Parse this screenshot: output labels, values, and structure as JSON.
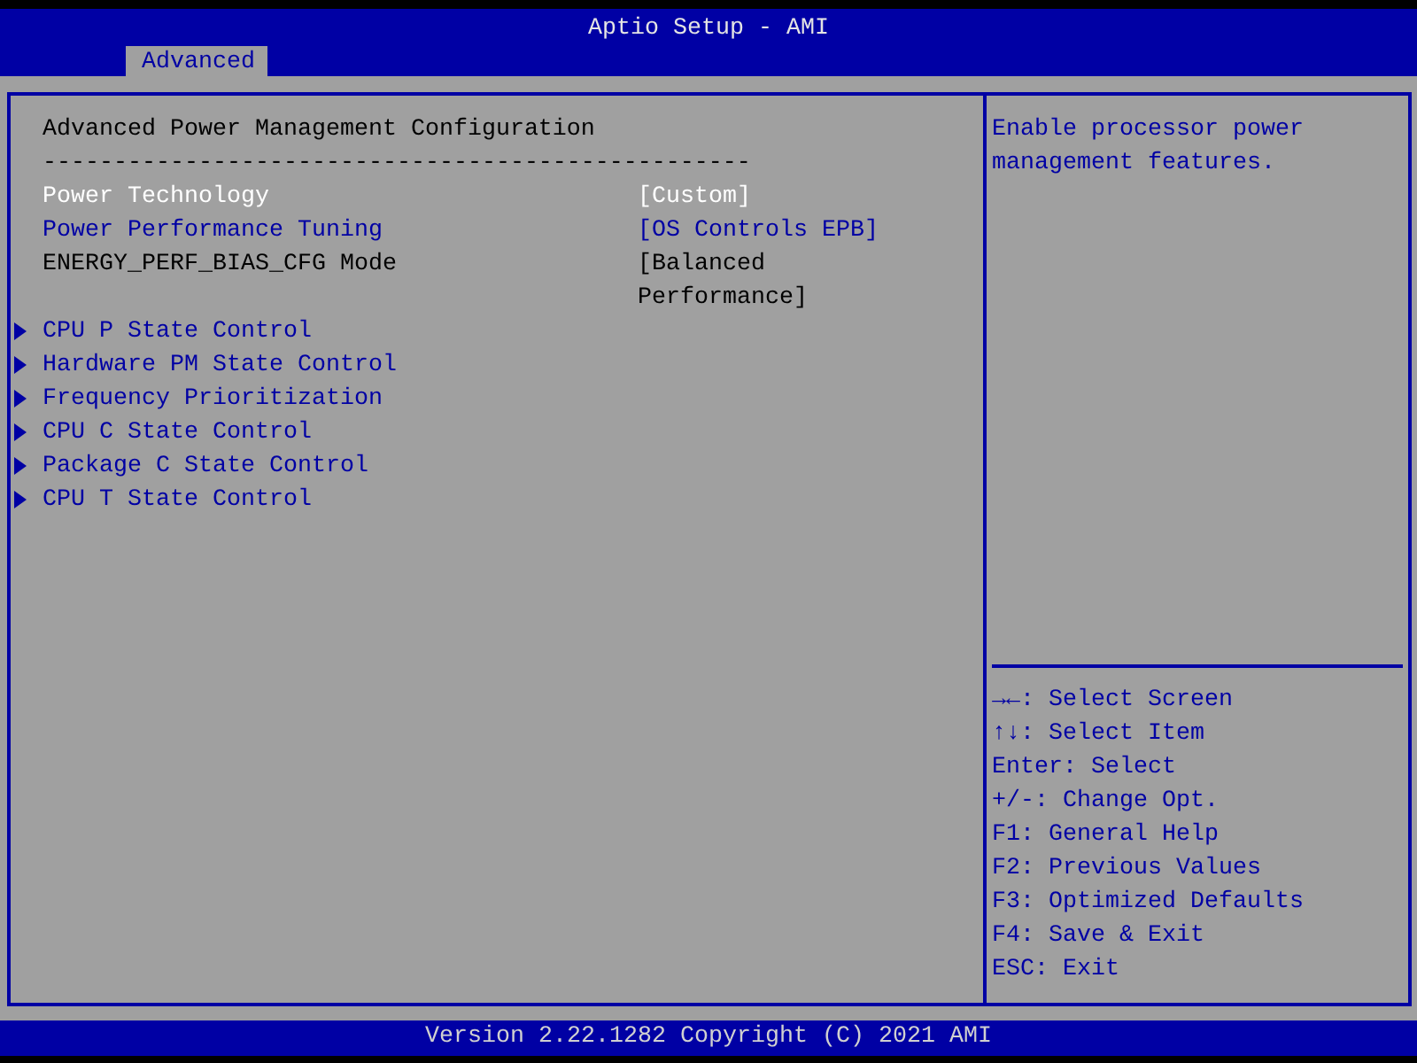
{
  "window": {
    "title": "Aptio Setup - AMI"
  },
  "tabs": [
    {
      "label": "Advanced",
      "selected": true
    }
  ],
  "page": {
    "title": "Advanced Power Management Configuration",
    "separator": "--------------------------------------------------"
  },
  "items": [
    {
      "kind": "setting",
      "label": "Power Technology",
      "value": "[Custom]",
      "selected": true,
      "disabled": false
    },
    {
      "kind": "setting",
      "label": "Power Performance Tuning",
      "value": "[OS Controls EPB]",
      "selected": false,
      "disabled": false
    },
    {
      "kind": "setting",
      "label": "ENERGY_PERF_BIAS_CFG Mode",
      "value": "[Balanced Performance]",
      "selected": false,
      "disabled": true
    },
    {
      "kind": "submenu",
      "label": "CPU P State Control",
      "selected": false,
      "disabled": false
    },
    {
      "kind": "submenu",
      "label": "Hardware PM State Control",
      "selected": false,
      "disabled": false
    },
    {
      "kind": "submenu",
      "label": "Frequency Prioritization",
      "selected": false,
      "disabled": false
    },
    {
      "kind": "submenu",
      "label": "CPU C State Control",
      "selected": false,
      "disabled": false
    },
    {
      "kind": "submenu",
      "label": "Package C State Control",
      "selected": false,
      "disabled": false
    },
    {
      "kind": "submenu",
      "label": "CPU T State Control",
      "selected": false,
      "disabled": false
    }
  ],
  "help": {
    "description": "Enable processor power management features.",
    "keys": [
      "**→←**: Select Screen",
      "**↑↓**: Select Item",
      "Enter: Select",
      "+/-: Change Opt.",
      "F1: General Help",
      "F2: Previous Values",
      "F3: Optimized Defaults",
      "F4: Save & Exit",
      "ESC: Exit"
    ]
  },
  "status_bar": {
    "text": "Version 2.22.1282 Copyright (C) 2021 AMI"
  }
}
